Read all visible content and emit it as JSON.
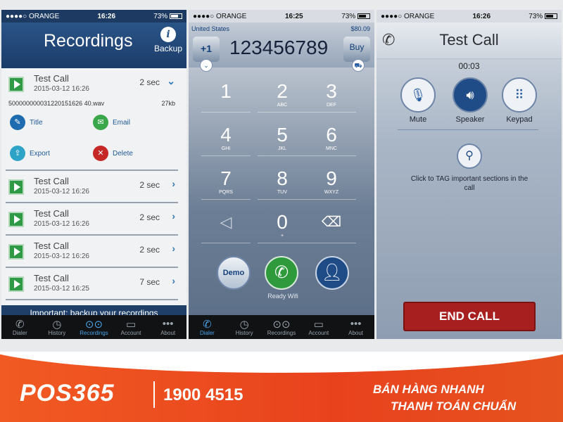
{
  "status_bars": [
    {
      "carrier": "●●●●○ ORANGE",
      "time": "16:26",
      "battery": "73%"
    },
    {
      "carrier": "●●●●○ ORANGE",
      "time": "16:25",
      "battery": "73%"
    },
    {
      "carrier": "●●●●○ ORANGE",
      "time": "16:26",
      "battery": "73%"
    }
  ],
  "recordings": {
    "title": "Recordings",
    "backup_label": "Backup",
    "expanded": {
      "name": "Test Call",
      "date": "2015-03-12 16:26",
      "duration": "2 sec",
      "filename": "500000000031220151626 40.wav",
      "filesize": "27kb",
      "actions": {
        "title": "Title",
        "email": "Email",
        "export": "Export",
        "delete": "Delete"
      }
    },
    "items": [
      {
        "name": "Test Call",
        "date": "2015-03-12 16:26",
        "duration": "2 sec"
      },
      {
        "name": "Test Call",
        "date": "2015-03-12 16:26",
        "duration": "2 sec"
      },
      {
        "name": "Test Call",
        "date": "2015-03-12 16:26",
        "duration": "2 sec"
      },
      {
        "name": "Test Call",
        "date": "2015-03-12 16:25",
        "duration": "7 sec"
      }
    ],
    "banner": "Important: backup your recordings"
  },
  "tabs": [
    "Dialer",
    "History",
    "Recordings",
    "Account",
    "About"
  ],
  "dialer": {
    "country": "United States",
    "balance": "$80.09",
    "prefix": "+1",
    "number": "123456789",
    "buy_label": "Buy",
    "keys": [
      {
        "digit": "1",
        "letters": ""
      },
      {
        "digit": "2",
        "letters": "ABC"
      },
      {
        "digit": "3",
        "letters": "DEF"
      },
      {
        "digit": "4",
        "letters": "GHI"
      },
      {
        "digit": "5",
        "letters": "JKL"
      },
      {
        "digit": "6",
        "letters": "MNC"
      },
      {
        "digit": "7",
        "letters": "PQRS"
      },
      {
        "digit": "8",
        "letters": "TUV"
      },
      {
        "digit": "9",
        "letters": "WXYZ"
      },
      {
        "digit": "0",
        "letters": "+"
      }
    ],
    "demo_label": "Demo",
    "ready_label": "Ready Wifi"
  },
  "call": {
    "title": "Test Call",
    "timer": "00:03",
    "mute_label": "Mute",
    "speaker_label": "Speaker",
    "keypad_label": "Keypad",
    "tag_hint": "Click to TAG important sections in the call",
    "end_label": "END CALL"
  },
  "footer": {
    "brand": "POS365",
    "hotline": "1900 4515",
    "tagline1": "BÁN HÀNG NHANH",
    "tagline2": "THANH TOÁN CHUẨN"
  }
}
